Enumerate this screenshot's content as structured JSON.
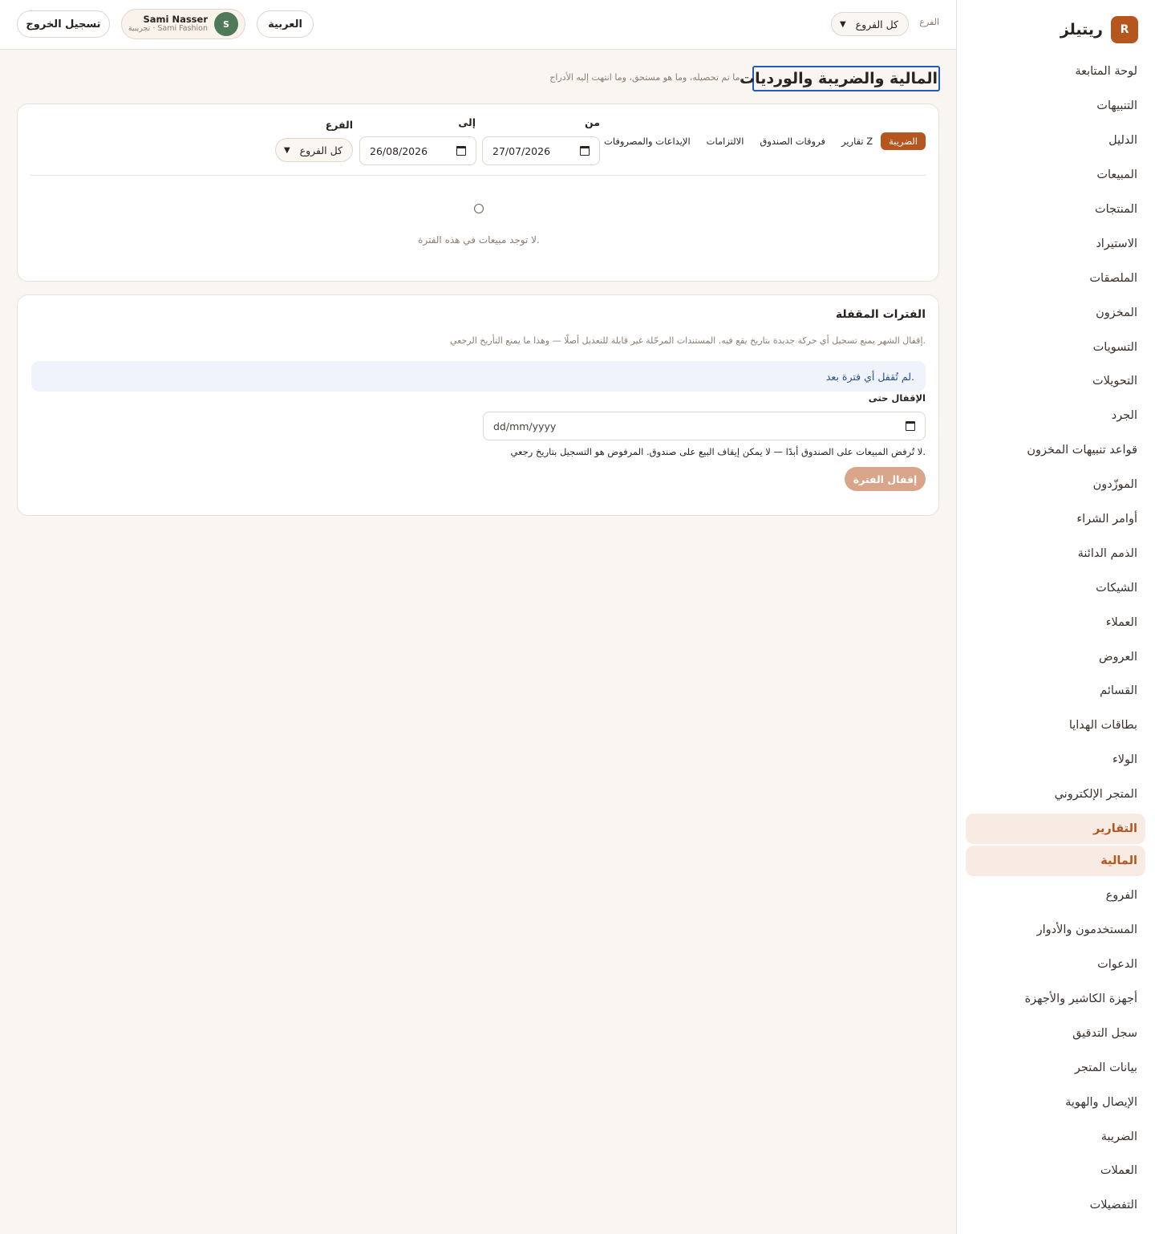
{
  "brand": {
    "badge": "R",
    "name": "ريتيلز"
  },
  "sidebar": {
    "items": [
      {
        "label": "لوحة المتابعة"
      },
      {
        "label": "التنبيهات"
      },
      {
        "label": "الدليل"
      },
      {
        "label": "المبيعات"
      },
      {
        "label": "المنتجات"
      },
      {
        "label": "الاستيراد"
      },
      {
        "label": "الملصقات"
      },
      {
        "label": "المخزون"
      },
      {
        "label": "التسويات"
      },
      {
        "label": "التحويلات"
      },
      {
        "label": "الجرد"
      },
      {
        "label": "قواعد تنبيهات المخزون"
      },
      {
        "label": "الموزّدون"
      },
      {
        "label": "أوامر الشراء"
      },
      {
        "label": "الذمم الدائنة"
      },
      {
        "label": "الشيكات"
      },
      {
        "label": "العملاء"
      },
      {
        "label": "العروض"
      },
      {
        "label": "القسائم"
      },
      {
        "label": "بطاقات الهدايا"
      },
      {
        "label": "الولاء"
      },
      {
        "label": "المتجر الإلكتروني"
      },
      {
        "label": "التقارير",
        "active": true
      },
      {
        "label": "المالية",
        "active": true
      },
      {
        "label": "الفروع"
      },
      {
        "label": "المستخدمون والأدوار"
      },
      {
        "label": "الدعوات"
      },
      {
        "label": "أجهزة الكاشير والأجهزة"
      },
      {
        "label": "سجل التدقيق"
      },
      {
        "label": "بيانات المتجر"
      },
      {
        "label": "الإيصال والهوية"
      },
      {
        "label": "الضريبة"
      },
      {
        "label": "العملات"
      },
      {
        "label": "التفضيلات"
      }
    ]
  },
  "header": {
    "branch_label": "الفرع",
    "branch_value": "كل الفروع",
    "language": "العربية",
    "logout": "تسجيل الخروج",
    "user": {
      "initial": "S",
      "name": "Sami Nasser",
      "sub": "تجريبية · Sami Fashion"
    }
  },
  "page": {
    "title": "المالية والضريبة والورديات",
    "subtitle": "ما تم تحصيله، وما هو مستحق، وما انتهت إليه الأدراج."
  },
  "report": {
    "tabs": [
      {
        "label": "الضريبة",
        "active": true
      },
      {
        "label": "تقارير Z"
      },
      {
        "label": "فروقات الصندوق"
      },
      {
        "label": "الالتزامات"
      },
      {
        "label": "الإيداعات والمصروفات"
      }
    ],
    "from_label": "من",
    "from_value": "27/07/2026",
    "to_label": "إلى",
    "to_value": "26/08/2026",
    "branch_label": "الفرع",
    "branch_value": "كل الفروع",
    "empty_text": "لا توجد مبيعات في هذه الفترة."
  },
  "locked": {
    "title": "الفترات المقفلة",
    "description": "إقفال الشهر يمنع تسجيل أي حركة جديدة بتاريخ يقع فيه. المستندات المرحّلة غير قابلة للتعديل أصلًا — وهذا ما يمنع التأريخ الرجعي.",
    "banner": "لم تُقفل أي فترة بعد.",
    "lock_until_label": "الإقفال حتى",
    "date_placeholder": "dd/mm/yyyy",
    "hint": "لا تُرفض المبيعات على الصندوق أبدًا — لا يمكن إيقاف البيع على صندوق. المرفوض هو التسجيل بتاريخ رجعي.",
    "button": "إقفال الفترة"
  },
  "colors": {
    "accent": "#b5561f",
    "avatar": "#4e7a5a",
    "focus": "#1f5bbf",
    "banner": "#eef3fc"
  }
}
